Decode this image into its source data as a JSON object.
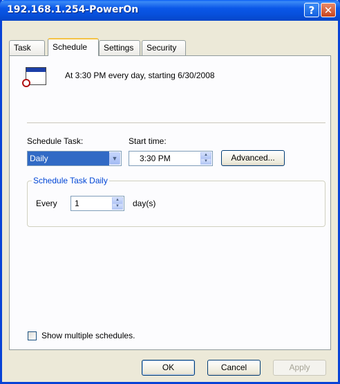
{
  "window": {
    "title": "192.168.1.254-PowerOn"
  },
  "titlebar": {
    "help_label": "?",
    "close_label": "✕"
  },
  "tabs": [
    {
      "label": "Task"
    },
    {
      "label": "Schedule"
    },
    {
      "label": "Settings"
    },
    {
      "label": "Security"
    }
  ],
  "schedule": {
    "summary": "At 3:30 PM every day, starting 6/30/2008",
    "task_label": "Schedule Task:",
    "task_value": "Daily",
    "start_label": "Start time:",
    "start_value": "3:30 PM",
    "advanced_label": "Advanced...",
    "group_label": "Schedule Task Daily",
    "every_label": "Every",
    "every_value": "1",
    "unit_label": "day(s)",
    "multiple_label": "Show multiple schedules."
  },
  "footer": {
    "ok_label": "OK",
    "cancel_label": "Cancel",
    "apply_label": "Apply"
  }
}
